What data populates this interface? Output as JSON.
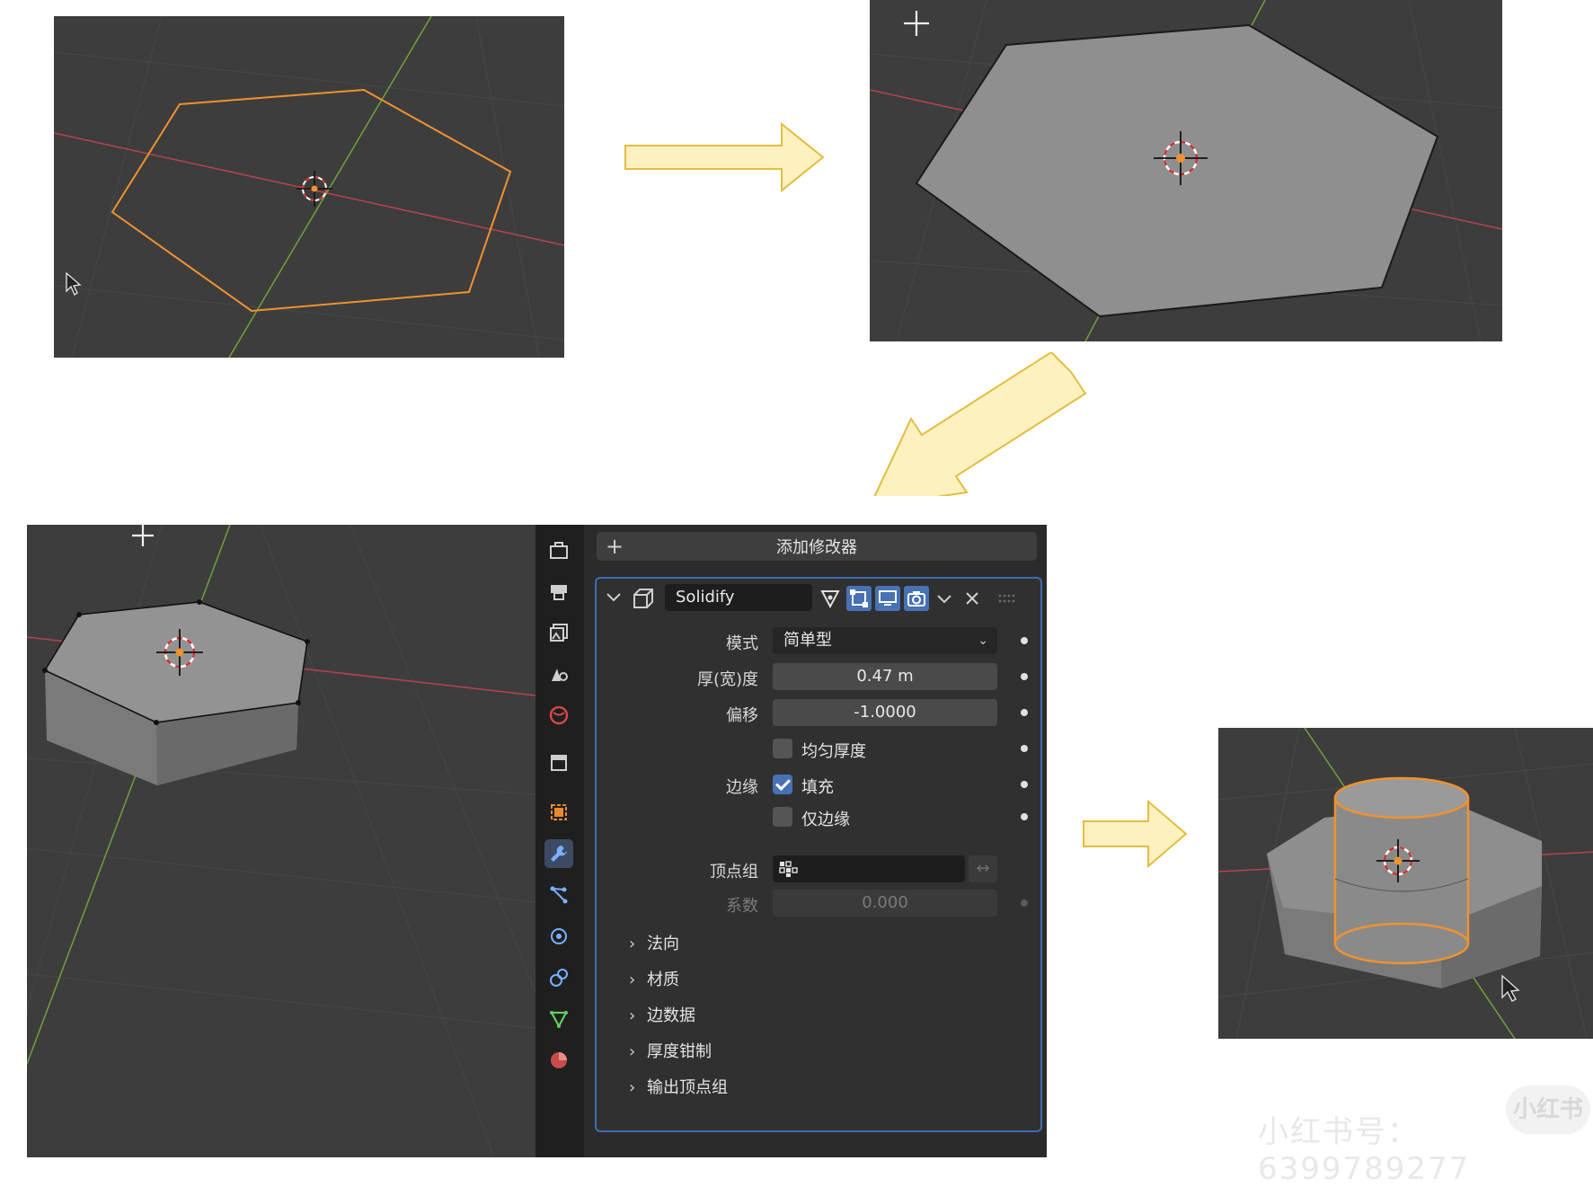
{
  "properties": {
    "add_modifier_label": "添加修改器",
    "modifier": {
      "name": "Solidify",
      "mode_label": "模式",
      "mode_value": "简单型",
      "thickness_label": "厚(宽)度",
      "thickness_value": "0.47 m",
      "offset_label": "偏移",
      "offset_value": "-1.0000",
      "even_thickness_label": "均匀厚度",
      "even_thickness_checked": false,
      "rim_label": "边缘",
      "fill_label": "填充",
      "fill_checked": true,
      "rim_only_label": "仅边缘",
      "rim_only_checked": false,
      "vertex_group_label": "顶点组",
      "vertex_group_value": "",
      "factor_label": "系数",
      "factor_value": "0.000",
      "sections": [
        "法向",
        "材质",
        "边数据",
        "厚度钳制",
        "输出顶点组"
      ]
    }
  },
  "watermark": {
    "text": "小红书号：6399789277",
    "badge": "小红书"
  },
  "colors": {
    "viewport_bg": "#3d3d3d",
    "selection_orange": "#f0922f",
    "mesh_gray": "#8f8f8f",
    "arrow_fill": "#fdf1bf",
    "arrow_stroke": "#e3bd3d",
    "active_blue": "#4772b3",
    "x_axis": "#b8434f",
    "y_axis": "#71a13c"
  }
}
